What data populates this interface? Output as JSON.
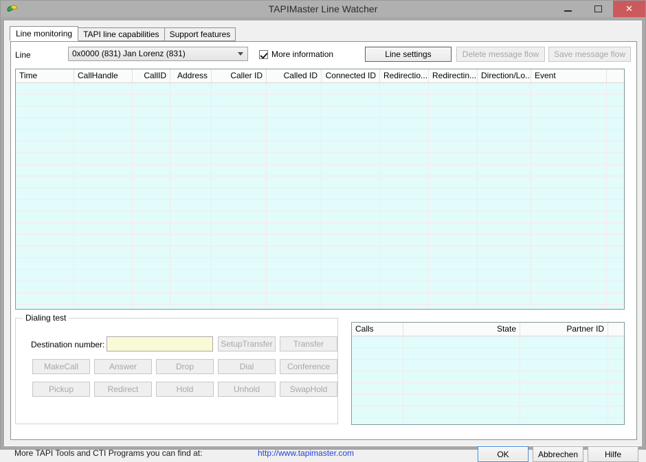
{
  "window": {
    "title": "TAPIMaster Line Watcher",
    "icon": "app-icon",
    "controls": {
      "minimize": "—",
      "maximize": "□",
      "close": "✕"
    }
  },
  "tabs": [
    {
      "label": "Line monitoring",
      "selected": true
    },
    {
      "label": "TAPI line capabilities",
      "selected": false
    },
    {
      "label": "Support features",
      "selected": false
    }
  ],
  "line_row": {
    "label": "Line",
    "combo_value": "0x0000 (831) Jan Lorenz (831)",
    "more_information_label": "More information",
    "more_information_checked": true,
    "buttons": [
      {
        "label": "Line settings",
        "enabled": true
      },
      {
        "label": "Delete message flow",
        "enabled": false
      },
      {
        "label": "Save message flow",
        "enabled": false
      }
    ]
  },
  "message_grid": {
    "columns": [
      {
        "label": "Time",
        "width": 85,
        "align": "left"
      },
      {
        "label": "CallHandle",
        "width": 85,
        "align": "left"
      },
      {
        "label": "CallID",
        "width": 55,
        "align": "right"
      },
      {
        "label": "Address",
        "width": 60,
        "align": "right"
      },
      {
        "label": "Caller ID",
        "width": 80,
        "align": "right"
      },
      {
        "label": "Called ID",
        "width": 80,
        "align": "right"
      },
      {
        "label": "Connected ID",
        "width": 85,
        "align": "right"
      },
      {
        "label": "Redirectio...",
        "width": 71,
        "align": "right"
      },
      {
        "label": "Redirectin...",
        "width": 71,
        "align": "right"
      },
      {
        "label": "Direction/Lo...",
        "width": 78,
        "align": "right"
      },
      {
        "label": "Event",
        "width": 110,
        "align": "left"
      }
    ],
    "rows": [],
    "row_count": 0,
    "background": "#e2fbfb"
  },
  "dialing_test": {
    "group_label": "Dialing test",
    "destination_label": "Destination number:",
    "destination_value": "",
    "destination_placeholder": "",
    "buttons": [
      {
        "label": "SetupTransfer",
        "enabled": false
      },
      {
        "label": "Transfer",
        "enabled": false
      },
      {
        "label": "MakeCall",
        "enabled": false
      },
      {
        "label": "Answer",
        "enabled": false
      },
      {
        "label": "Drop",
        "enabled": false
      },
      {
        "label": "Dial",
        "enabled": false
      },
      {
        "label": "Conference",
        "enabled": false
      },
      {
        "label": "Pickup",
        "enabled": false
      },
      {
        "label": "Redirect",
        "enabled": false
      },
      {
        "label": "Hold",
        "enabled": false
      },
      {
        "label": "Unhold",
        "enabled": false
      },
      {
        "label": "SwapHold",
        "enabled": false
      }
    ]
  },
  "calls_list": {
    "columns": [
      {
        "label": "Calls",
        "width": 75,
        "align": "left"
      },
      {
        "label": "State",
        "width": 170,
        "align": "right"
      },
      {
        "label": "Partner ID",
        "width": 128,
        "align": "right"
      }
    ],
    "rows": [],
    "row_count": 0
  },
  "footer": {
    "text": "More TAPI Tools and CTI Programs you can find at:",
    "link": "http://www.tapimaster.com",
    "buttons": [
      {
        "label": "OK",
        "default": true
      },
      {
        "label": "Abbrechen",
        "default": false
      },
      {
        "label": "Hilfe",
        "default": false
      }
    ]
  },
  "colors": {
    "titlebar": "#b0b0b0",
    "close_button": "#cc5a5d",
    "grid_background": "#e2fbfb",
    "grid_border": "#7f9a9c",
    "input_yellow": "#fafad7",
    "link": "#2440d8",
    "focus_blue": "#3c86cf"
  }
}
